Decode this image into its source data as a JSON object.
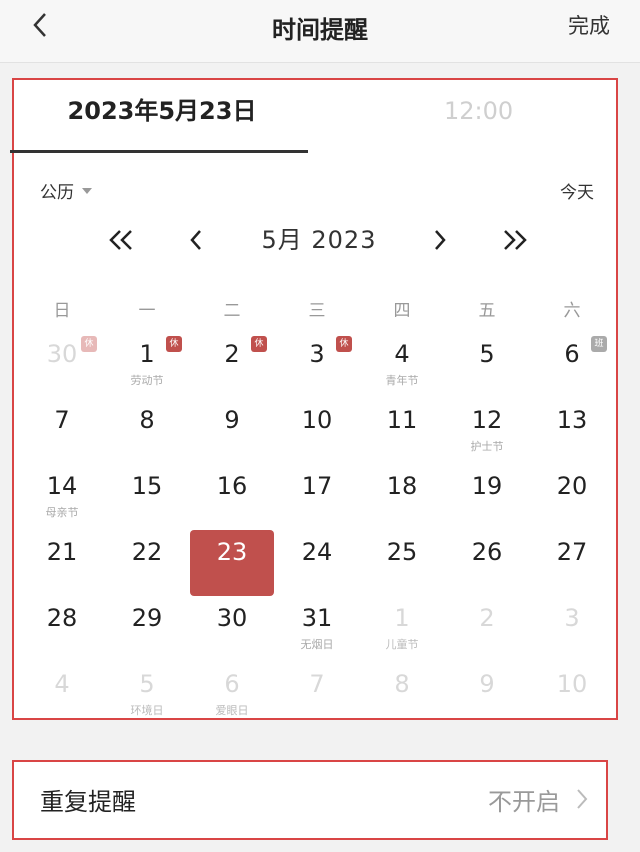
{
  "nav": {
    "title": "时间提醒",
    "done_label": "完成",
    "back_icon": "chevron-left-icon"
  },
  "tabs": {
    "date_label": "2023年5月23日",
    "time_label": "12:00"
  },
  "calendar": {
    "type_label": "公历",
    "today_label": "今天",
    "month_label": "5月  2023",
    "weekdays": [
      "日",
      "一",
      "二",
      "三",
      "四",
      "五",
      "六"
    ],
    "days": [
      {
        "n": "30",
        "dim": true,
        "badge": "休",
        "badge_style": "light"
      },
      {
        "n": "1",
        "sub": "劳动节",
        "badge": "休"
      },
      {
        "n": "2",
        "badge": "休"
      },
      {
        "n": "3",
        "badge": "休"
      },
      {
        "n": "4",
        "sub": "青年节"
      },
      {
        "n": "5"
      },
      {
        "n": "6",
        "badge": "班",
        "badge_style": "gray"
      },
      {
        "n": "7"
      },
      {
        "n": "8"
      },
      {
        "n": "9"
      },
      {
        "n": "10"
      },
      {
        "n": "11"
      },
      {
        "n": "12",
        "sub": "护士节"
      },
      {
        "n": "13"
      },
      {
        "n": "14",
        "sub": "母亲节"
      },
      {
        "n": "15"
      },
      {
        "n": "16"
      },
      {
        "n": "17"
      },
      {
        "n": "18"
      },
      {
        "n": "19"
      },
      {
        "n": "20"
      },
      {
        "n": "21"
      },
      {
        "n": "22"
      },
      {
        "n": "23",
        "selected": true
      },
      {
        "n": "24"
      },
      {
        "n": "25"
      },
      {
        "n": "26"
      },
      {
        "n": "27"
      },
      {
        "n": "28"
      },
      {
        "n": "29"
      },
      {
        "n": "30"
      },
      {
        "n": "31",
        "sub": "无烟日"
      },
      {
        "n": "1",
        "dim": true,
        "sub": "儿童节"
      },
      {
        "n": "2",
        "dim": true
      },
      {
        "n": "3",
        "dim": true
      },
      {
        "n": "4",
        "dim": true
      },
      {
        "n": "5",
        "dim": true,
        "sub": "环境日"
      },
      {
        "n": "6",
        "dim": true,
        "sub": "爱眼日"
      },
      {
        "n": "7",
        "dim": true
      },
      {
        "n": "8",
        "dim": true
      },
      {
        "n": "9",
        "dim": true
      },
      {
        "n": "10",
        "dim": true
      }
    ]
  },
  "repeat": {
    "label": "重复提醒",
    "value": "不开启"
  },
  "colors": {
    "accent": "#c0504d",
    "highlight_border": "#d94545"
  }
}
